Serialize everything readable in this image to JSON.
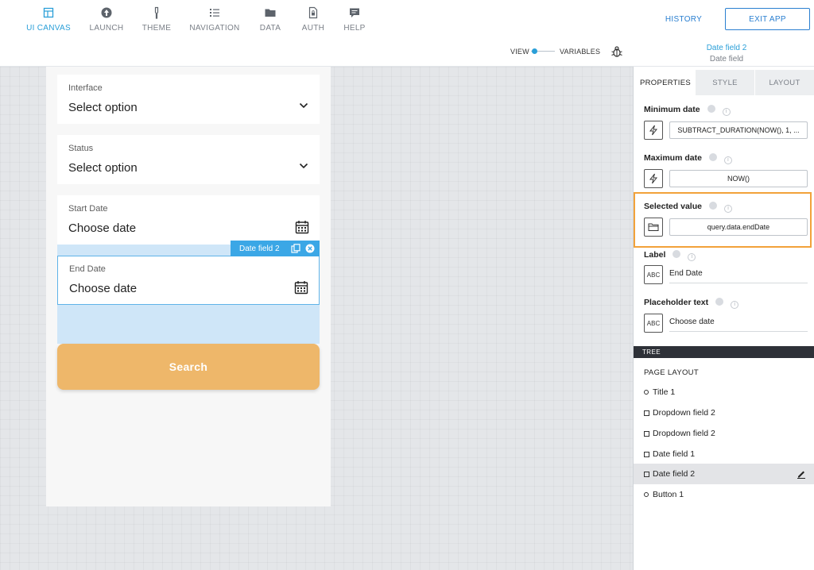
{
  "nav": {
    "items": [
      {
        "label": "UI CANVAS",
        "icon": "layout-icon",
        "active": true
      },
      {
        "label": "LAUNCH",
        "icon": "rocket-icon"
      },
      {
        "label": "THEME",
        "icon": "brush-icon"
      },
      {
        "label": "NAVIGATION",
        "icon": "list-icon"
      },
      {
        "label": "DATA",
        "icon": "folder-icon"
      },
      {
        "label": "AUTH",
        "icon": "lock-file-icon"
      },
      {
        "label": "HELP",
        "icon": "chat-icon"
      }
    ],
    "history_label": "HISTORY",
    "exit_label": "EXIT APP"
  },
  "subbar": {
    "view_label": "VIEW",
    "variables_label": "VARIABLES",
    "selected_title": "Date field 2",
    "selected_type": "Date field"
  },
  "canvas": {
    "fields": [
      {
        "label": "Interface",
        "value": "Select option",
        "kind": "dropdown"
      },
      {
        "label": "Status",
        "value": "Select option",
        "kind": "dropdown"
      },
      {
        "label": "Start Date",
        "value": "Choose date",
        "kind": "date"
      },
      {
        "label": "End Date",
        "value": "Choose date",
        "kind": "date"
      }
    ],
    "selection_tag": "Date field 2",
    "search_label": "Search"
  },
  "panel": {
    "tabs": [
      "PROPERTIES",
      "STYLE",
      "LAYOUT"
    ],
    "props": {
      "min_date_label": "Minimum date",
      "min_date_value": "SUBTRACT_DURATION(NOW(), 1, ...",
      "max_date_label": "Maximum date",
      "max_date_value": "NOW()",
      "selected_label": "Selected value",
      "selected_value": "query.data.endDate",
      "label_label": "Label",
      "label_value": "End Date",
      "placeholder_label": "Placeholder text",
      "placeholder_value": "Choose date",
      "text_type": "ABC"
    },
    "tree": {
      "bar_label": "TREE",
      "head": "PAGE LAYOUT",
      "items": [
        "Title 1",
        "Dropdown field 2",
        "Dropdown field 2",
        "Date field 1",
        "Date field 2",
        "Button 1"
      ]
    }
  },
  "colors": {
    "accent": "#2a9fd8",
    "search_button": "#eeb76a",
    "highlight_border": "#f2a23a"
  }
}
